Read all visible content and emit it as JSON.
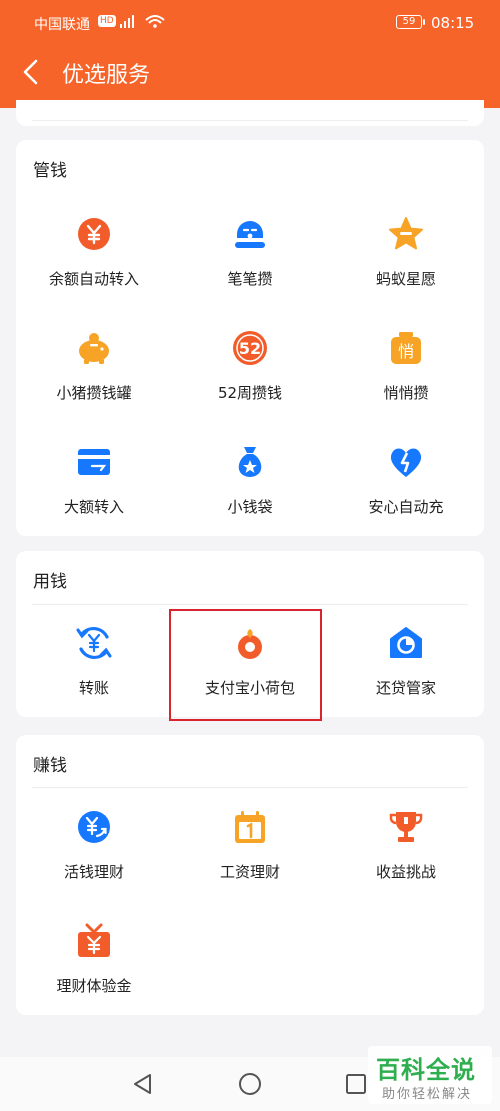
{
  "status_bar": {
    "carrier": "中国联通",
    "network_badge": "HD",
    "battery": "59",
    "time": "08:15"
  },
  "header": {
    "title": "优选服务",
    "background": "#f7642a"
  },
  "sections": [
    {
      "title": "管钱",
      "items": [
        {
          "label": "余额自动转入",
          "icon": "yen-circle-icon",
          "color": "#f25c2a"
        },
        {
          "label": "笔笔攒",
          "icon": "piggy-face-icon",
          "color": "#1677ff"
        },
        {
          "label": "蚂蚁星愿",
          "icon": "star-icon",
          "color": "#f7a325"
        },
        {
          "label": "小猪攒钱罐",
          "icon": "piggy-bank-icon",
          "color": "#f7a325"
        },
        {
          "label": "52周攒钱",
          "icon": "52-badge-icon",
          "color": "#f25c2a"
        },
        {
          "label": "悄悄攒",
          "icon": "secret-jar-icon",
          "color": "#f7a325"
        },
        {
          "label": "大额转入",
          "icon": "card-transfer-icon",
          "color": "#1677ff"
        },
        {
          "label": "小钱袋",
          "icon": "money-bag-icon",
          "color": "#1677ff"
        },
        {
          "label": "安心自动充",
          "icon": "heart-charge-icon",
          "color": "#1677ff"
        }
      ]
    },
    {
      "title": "用钱",
      "items": [
        {
          "label": "转账",
          "icon": "transfer-icon",
          "color": "#1677ff"
        },
        {
          "label": "支付宝小荷包",
          "icon": "lotus-purse-icon",
          "color": "#f25c2a"
        },
        {
          "label": "还贷管家",
          "icon": "loan-manager-icon",
          "color": "#1677ff"
        }
      ]
    },
    {
      "title": "赚钱",
      "items": [
        {
          "label": "活钱理财",
          "icon": "yen-flow-icon",
          "color": "#1677ff"
        },
        {
          "label": "工资理财",
          "icon": "calendar-icon",
          "color": "#f7a325"
        },
        {
          "label": "收益挑战",
          "icon": "trophy-icon",
          "color": "#f25c2a"
        },
        {
          "label": "理财体验金",
          "icon": "gift-yen-icon",
          "color": "#f25c2a"
        }
      ]
    }
  ],
  "highlight_color": "#d9232e",
  "watermark": {
    "main": "百科全说",
    "sub": "助你轻松解决"
  }
}
